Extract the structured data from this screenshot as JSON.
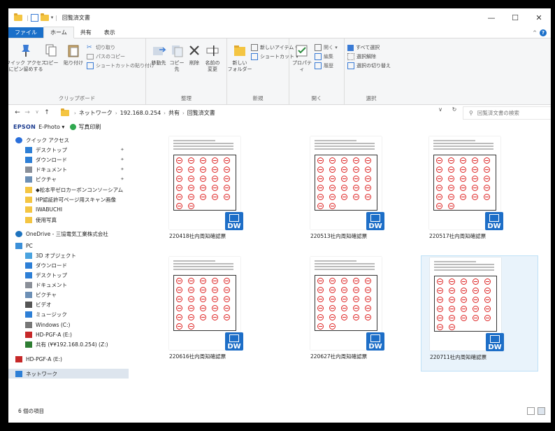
{
  "window": {
    "title": "回覧済文書",
    "controls": {
      "minimize": "—",
      "maximize": "☐",
      "close": "✕"
    }
  },
  "ribbon_tabs": [
    "ファイル",
    "ホーム",
    "共有",
    "表示"
  ],
  "ribbon": {
    "clipboard": {
      "label": "クリップボード",
      "pin": "クイック アクセス\nにピン留めする",
      "copy": "コピー",
      "paste": "貼り付け",
      "cut": "切り取り",
      "copy_path": "パスのコピー",
      "paste_shortcut": "ショートカットの貼り付け"
    },
    "organize": {
      "label": "整理",
      "move_to": "移動先",
      "copy_to": "コピー先",
      "delete": "削除",
      "rename": "名前の\n変更"
    },
    "new": {
      "label": "新規",
      "new_folder": "新しい\nフォルダー",
      "new_item": "新しいアイテム ▾",
      "shortcut": "ショートカット ▾"
    },
    "open": {
      "label": "開く",
      "properties": "プロパティ",
      "open": "開く ▾",
      "edit": "編集",
      "history": "履歴"
    },
    "select": {
      "label": "選択",
      "select_all": "すべて選択",
      "select_none": "選択解除",
      "invert": "選択の切り替え"
    }
  },
  "address": {
    "segments": [
      "ネットワーク",
      "192.168.0.254",
      "共有",
      "回覧済文書"
    ],
    "search_placeholder": "回覧済文書の検索"
  },
  "epson_bar": {
    "brand": "EPSON",
    "product": "E-Photo ▾",
    "action": "写真印刷"
  },
  "nav_pane": [
    {
      "label": "クイック アクセス",
      "icon": "star-icon",
      "indent": 0,
      "pinned": false
    },
    {
      "label": "デスクトップ",
      "icon": "desktop-icon",
      "indent": 1,
      "pinned": true
    },
    {
      "label": "ダウンロード",
      "icon": "download-icon",
      "indent": 1,
      "pinned": true
    },
    {
      "label": "ドキュメント",
      "icon": "document-icon",
      "indent": 1,
      "pinned": true
    },
    {
      "label": "ピクチャ",
      "icon": "picture-icon",
      "indent": 1,
      "pinned": true
    },
    {
      "label": "◆松本平ゼロカーボンコンソーシアム",
      "icon": "folder-icon",
      "indent": 1,
      "pinned": false
    },
    {
      "label": "HP認証許可ページ用スキャン画像",
      "icon": "folder-icon",
      "indent": 1,
      "pinned": false
    },
    {
      "label": "IWABUCHI",
      "icon": "folder-icon",
      "indent": 1,
      "pinned": false
    },
    {
      "label": "使用写真",
      "icon": "folder-icon",
      "indent": 1,
      "pinned": false
    },
    {
      "label": "OneDrive - 三協電気工業株式会社",
      "icon": "cloud-icon",
      "indent": 0,
      "pinned": false
    },
    {
      "label": "PC",
      "icon": "pc-icon",
      "indent": 0,
      "pinned": false
    },
    {
      "label": "3D オブジェクト",
      "icon": "cube-icon",
      "indent": 1,
      "pinned": false
    },
    {
      "label": "ダウンロード",
      "icon": "download-icon",
      "indent": 1,
      "pinned": false
    },
    {
      "label": "デスクトップ",
      "icon": "desktop-icon",
      "indent": 1,
      "pinned": false
    },
    {
      "label": "ドキュメント",
      "icon": "document-icon",
      "indent": 1,
      "pinned": false
    },
    {
      "label": "ピクチャ",
      "icon": "picture-icon",
      "indent": 1,
      "pinned": false
    },
    {
      "label": "ビデオ",
      "icon": "video-icon",
      "indent": 1,
      "pinned": false
    },
    {
      "label": "ミュージック",
      "icon": "music-icon",
      "indent": 1,
      "pinned": false
    },
    {
      "label": "Windows (C:)",
      "icon": "drive-icon",
      "indent": 1,
      "pinned": false
    },
    {
      "label": "HD-PGF-A (E:)",
      "icon": "usb-drive-icon",
      "indent": 1,
      "pinned": false
    },
    {
      "label": "共有 (¥¥192.168.0.254) (Z:)",
      "icon": "network-drive-icon",
      "indent": 1,
      "pinned": false
    },
    {
      "label": "HD-PGF-A (E:)",
      "icon": "usb-drive-icon",
      "indent": 0,
      "pinned": false
    },
    {
      "label": "ネットワーク",
      "icon": "network-icon",
      "indent": 0,
      "pinned": false,
      "selected": true
    }
  ],
  "files": [
    {
      "name": "220418社内周知確認票",
      "selected": false
    },
    {
      "name": "220513社内周知確認票",
      "selected": false
    },
    {
      "name": "220517社内周知確認票",
      "selected": false
    },
    {
      "name": "220616社内周知確認票",
      "selected": false
    },
    {
      "name": "220627社内周知確認票",
      "selected": false
    },
    {
      "name": "220711社内周知確認票",
      "selected": true
    }
  ],
  "dw_badge": "DW",
  "status": {
    "count": "6 個の項目"
  },
  "colors": {
    "accent": "#1a6fc9",
    "selection": "#dde5ee",
    "stamp": "#dd2222"
  }
}
